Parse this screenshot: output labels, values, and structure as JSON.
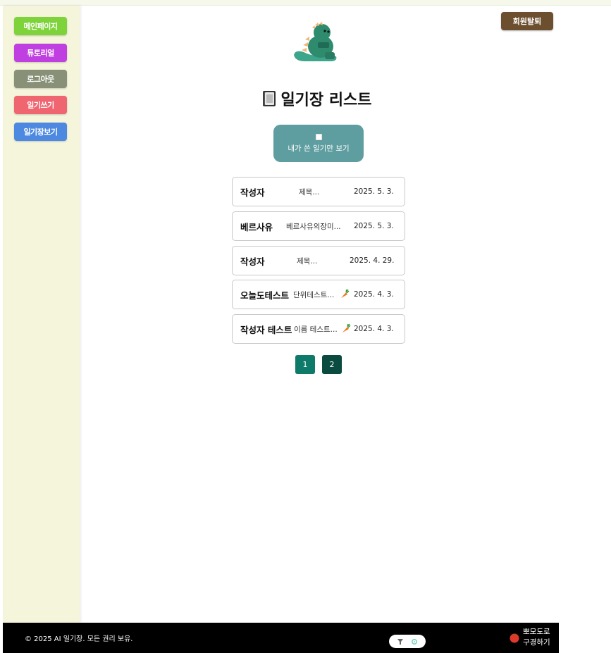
{
  "sidebar": {
    "items": [
      {
        "label": "메인페이지",
        "color": "#7ed33a"
      },
      {
        "label": "튜토리얼",
        "color": "#c03fe0"
      },
      {
        "label": "로그아웃",
        "color": "#889177"
      },
      {
        "label": "일기쓰기",
        "color": "#ef6570"
      },
      {
        "label": "일기장보기",
        "color": "#4d89e0"
      }
    ]
  },
  "header": {
    "withdraw_label": "회원탈퇴"
  },
  "main": {
    "title": "일기장 리스트",
    "filter_label": "내가 쓴 일기만 보기",
    "diaries": [
      {
        "author": "작성자",
        "title": "제목...",
        "icon": "",
        "date": "2025. 5. 3."
      },
      {
        "author": "베르사유",
        "title": "베르사유의장미...",
        "icon": "",
        "date": "2025. 5. 3."
      },
      {
        "author": "작성자",
        "title": "제목...",
        "icon": "",
        "date": "2025. 4. 29."
      },
      {
        "author": "오늘도테스트",
        "title": "단위테스트...",
        "icon": "carrot-icon",
        "date": "2025. 4. 3."
      },
      {
        "author": "작성자 테스트",
        "title": "이름 테스트...",
        "icon": "carrot-icon",
        "date": "2025. 4. 3."
      }
    ],
    "pagination": [
      {
        "label": "1",
        "active": false
      },
      {
        "label": "2",
        "active": true
      }
    ]
  },
  "footer": {
    "copyright": "© 2025 AI 일기장. 모든 권리 보유.",
    "pomodoro_line1": "뽀모도로",
    "pomodoro_line2": "구경하기"
  },
  "colors": {
    "accent_teal": "#5f9ea0",
    "page_btn": "#0d7a6a",
    "page_btn_active": "#0a4a3f",
    "withdraw": "#6b4f2e"
  }
}
